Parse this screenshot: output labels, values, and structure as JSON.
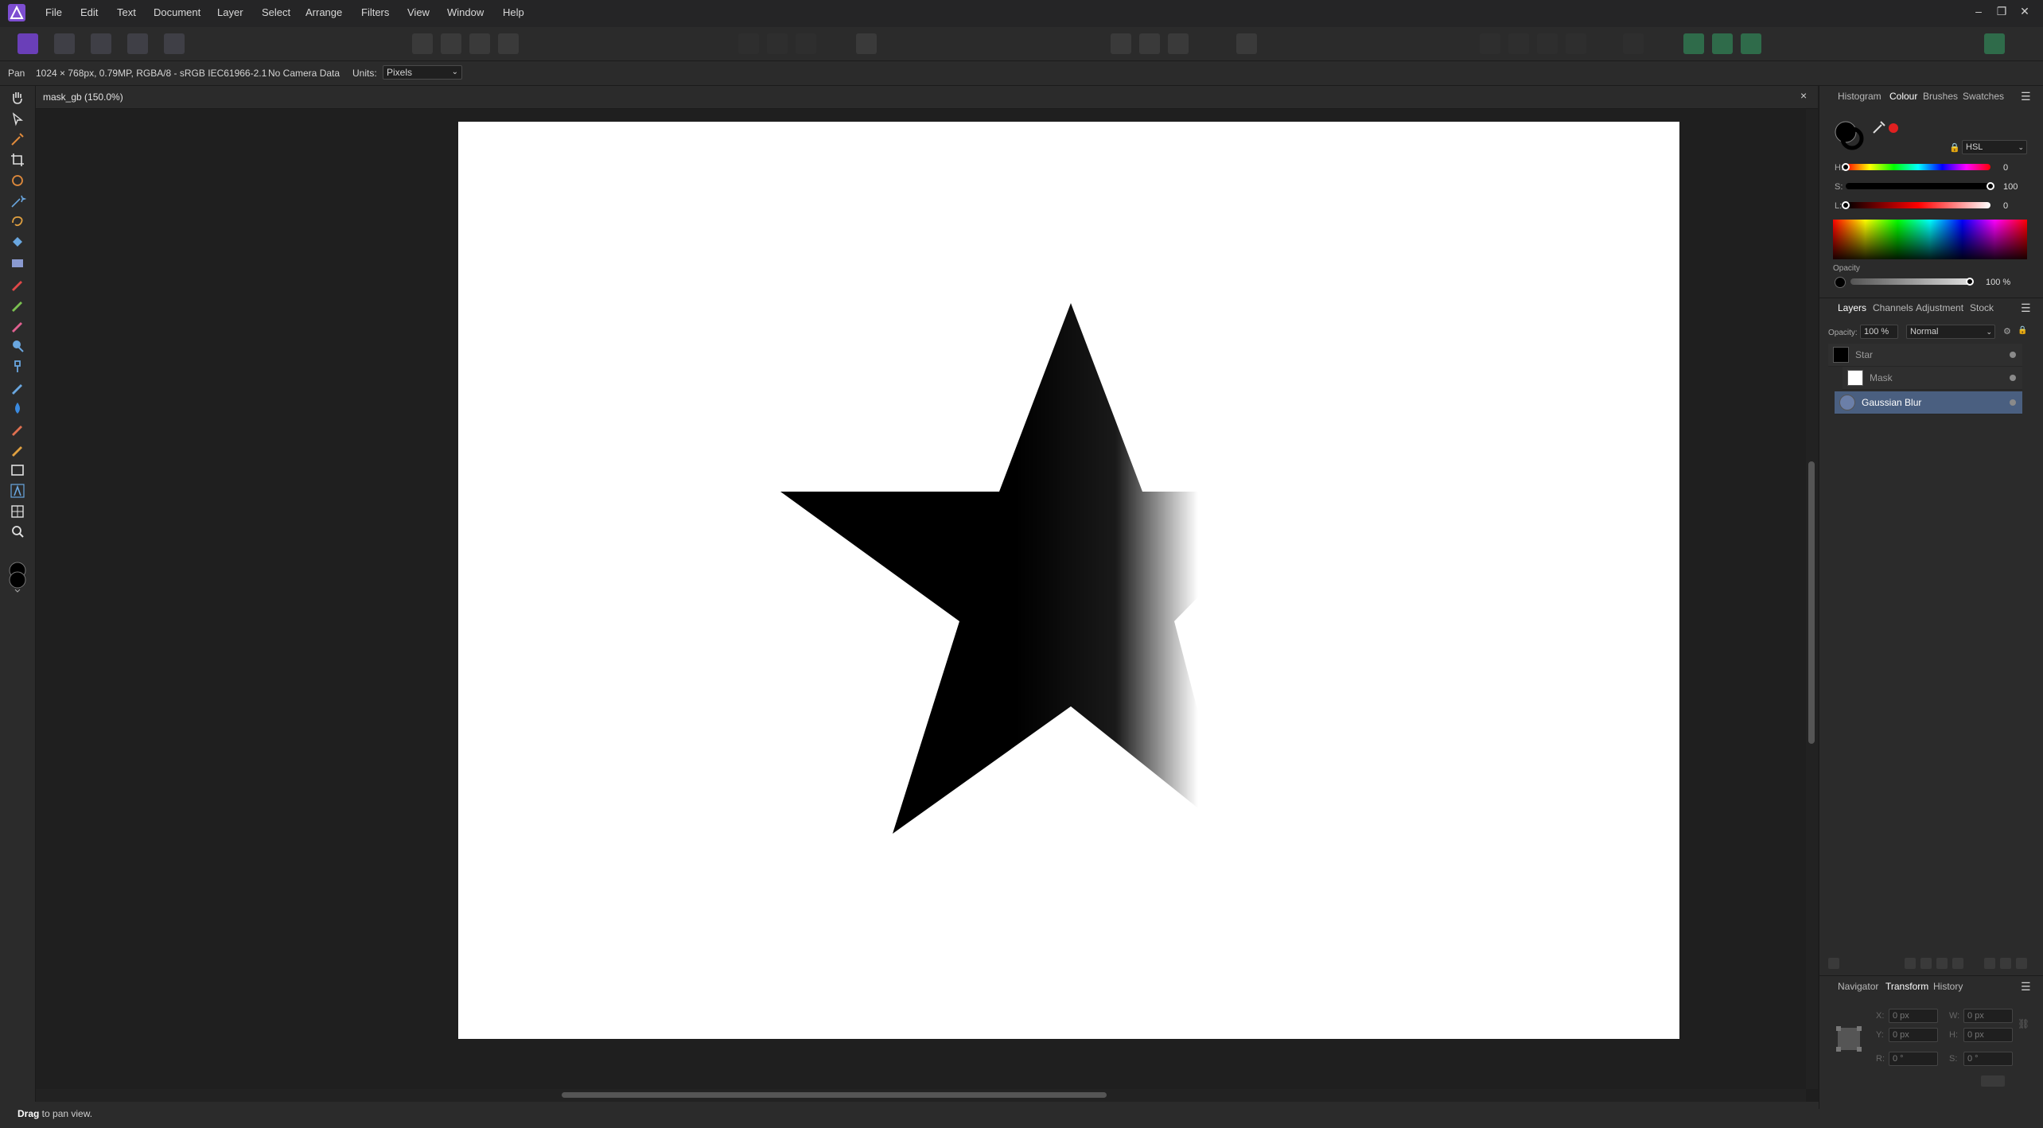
{
  "menu": {
    "items": [
      "File",
      "Edit",
      "Text",
      "Document",
      "Layer",
      "Select",
      "Arrange",
      "Filters",
      "View",
      "Window",
      "Help"
    ]
  },
  "window_controls": {
    "minimize": "–",
    "restore": "❐",
    "close": "✕"
  },
  "context": {
    "tool_name": "Pan",
    "document_info": "1024 × 768px, 0.79MP, RGBA/8 - sRGB IEC61966-2.1",
    "camera": "No Camera Data",
    "units_label": "Units:",
    "units_value": "Pixels"
  },
  "document": {
    "tab_title": "mask_gb (150.0%)",
    "close": "×"
  },
  "status": {
    "bold": "Drag",
    "text": " to pan view."
  },
  "colour_panel": {
    "tabs": [
      "Histogram",
      "Colour",
      "Brushes",
      "Swatches"
    ],
    "active_tab": "Colour",
    "model": "HSL",
    "h_label": "H:",
    "h_value": "0",
    "s_label": "S:",
    "s_value": "100",
    "l_label": "L:",
    "l_value": "0",
    "opacity_label": "Opacity",
    "opacity_value": "100 %",
    "h_fraction": 0.0,
    "s_fraction": 1.0,
    "l_fraction": 0.0,
    "opacity_fraction": 1.0,
    "accent": "#e02020"
  },
  "layers_panel": {
    "tabs": [
      "Layers",
      "Channels",
      "Adjustment",
      "Stock"
    ],
    "active_tab": "Layers",
    "opacity_label": "Opacity:",
    "opacity_value": "100 %",
    "blend_mode": "Normal",
    "layers": [
      {
        "name": "Star",
        "selected": false
      },
      {
        "name": "Mask",
        "selected": false
      },
      {
        "name": "Gaussian Blur",
        "selected": true
      }
    ],
    "selected_color": "#4a5f80"
  },
  "transform_panel": {
    "tabs": [
      "Navigator",
      "Transform",
      "History"
    ],
    "active_tab": "Transform",
    "x_label": "X:",
    "x_value": "0 px",
    "y_label": "Y:",
    "y_value": "0 px",
    "w_label": "W:",
    "w_value": "0 px",
    "h_label": "H:",
    "h_value": "0 px",
    "r_label": "R:",
    "r_value": "0 °",
    "s_label": "S:",
    "s_value": "0 °"
  }
}
